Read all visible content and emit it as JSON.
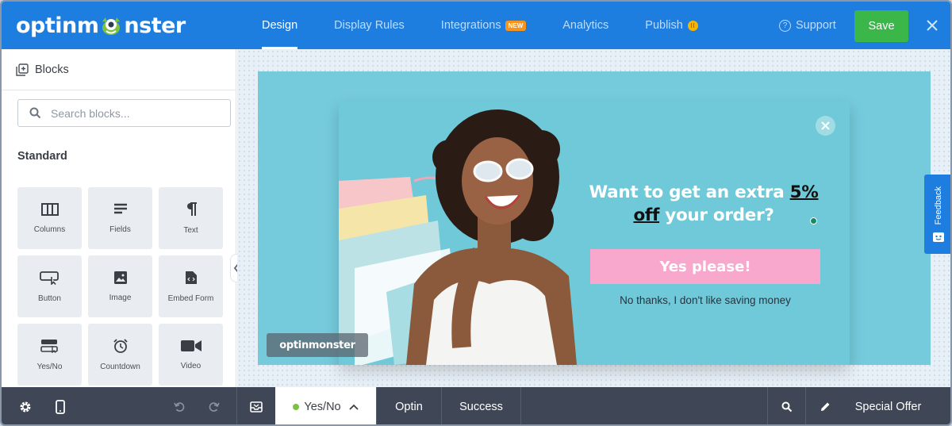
{
  "header": {
    "logo_text_left": "optinm",
    "logo_text_right": "nster",
    "nav": [
      {
        "label": "Design",
        "active": true
      },
      {
        "label": "Display Rules"
      },
      {
        "label": "Integrations",
        "badge": "NEW"
      },
      {
        "label": "Analytics"
      },
      {
        "label": "Publish",
        "status": "paused"
      }
    ],
    "support_label": "Support",
    "save_label": "Save",
    "accent_color": "#1e7ee0",
    "save_color": "#3bb74a"
  },
  "sidebar": {
    "title": "Blocks",
    "search_placeholder": "Search blocks...",
    "section_label": "Standard",
    "blocks": [
      {
        "label": "Columns",
        "icon": "columns-icon"
      },
      {
        "label": "Fields",
        "icon": "fields-icon"
      },
      {
        "label": "Text",
        "icon": "paragraph-icon"
      },
      {
        "label": "Button",
        "icon": "button-icon"
      },
      {
        "label": "Image",
        "icon": "image-icon"
      },
      {
        "label": "Embed Form",
        "icon": "embed-form-icon"
      },
      {
        "label": "Yes/No",
        "icon": "yes-no-icon"
      },
      {
        "label": "Countdown",
        "icon": "countdown-icon"
      },
      {
        "label": "Video",
        "icon": "video-icon"
      }
    ]
  },
  "popup": {
    "headline_part1": "Want to get an extra ",
    "headline_highlight1": "5%",
    "headline_highlight2": "off",
    "headline_part2": " your order?",
    "yes_button": "Yes please!",
    "no_link": "No thanks, I don't like saving money",
    "branding": "optinmonster",
    "bg_color": "#6fc9d8",
    "button_color": "#f8a8cd"
  },
  "feedback_label": "Feedback",
  "bottombar": {
    "tabs": [
      {
        "label": "Yes/No",
        "active": true
      },
      {
        "label": "Optin"
      },
      {
        "label": "Success"
      }
    ],
    "campaign_name": "Special Offer"
  }
}
